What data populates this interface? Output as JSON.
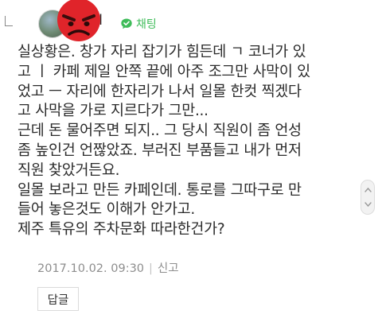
{
  "comment": {
    "author_suffix": "l",
    "chat_label": "채팅",
    "lines": [
      "실상황은. 창가 자리 잡기가 힘든데 ㄱ 코너가 있",
      "고 ㅣ 카페 제일 안쪽 끝에 아주 조그만 사막이 있",
      "었고 ㅡ 자리에 한자리가 나서 일몰 한컷 찍겠다",
      "고 사막을 가로 지르다가 그만...",
      "근데 돈 물어주면 되지.. 그 당시 직원이 좀 언성",
      "좀 높인건 언짢았죠. 부러진 부품들고 내가 먼저",
      "직원 찾았거든요.",
      "일몰 보라고 만든 카페인데. 통로를 그따구로 만",
      "들어 놓은것도 이해가 안가고.",
      "제주 특유의 주차문화 따라한건가?"
    ],
    "timestamp": "2017.10.02. 09:30",
    "report_label": "신고",
    "reply_button_label": "답글"
  },
  "icons": {
    "reply_indicator": "reply-corner-icon",
    "emoji_overlay": "angry-face-emoji",
    "chat": "chat-bubble-icon",
    "scroll": "scroll-handle-icon"
  },
  "colors": {
    "chat_green": "#3fbc5a",
    "emoji_red": "#e0242a",
    "meta_gray": "#8e8e8e"
  }
}
